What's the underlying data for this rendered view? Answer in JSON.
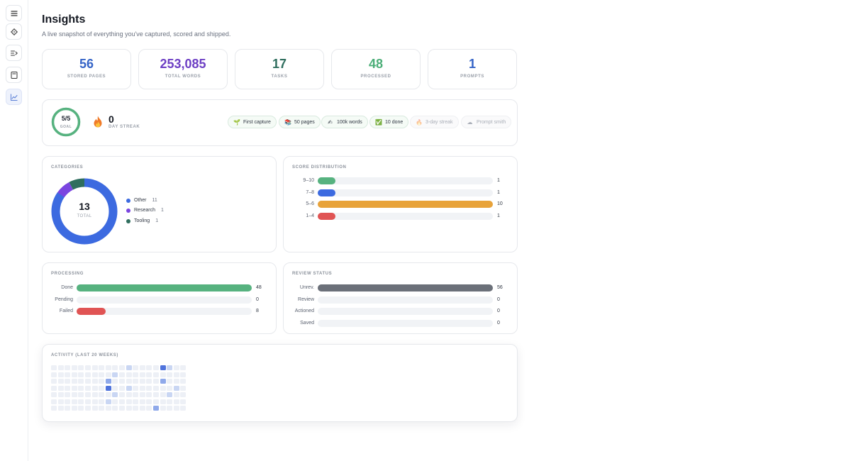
{
  "sidebar": {
    "items": [
      {
        "icon": "menu-icon",
        "active": false
      },
      {
        "icon": "target-icon",
        "active": false
      },
      {
        "icon": "list-arrow-icon",
        "active": false
      },
      {
        "icon": "note-icon",
        "active": false
      },
      {
        "icon": "chart-line-icon",
        "active": true
      }
    ]
  },
  "header": {
    "title": "Insights",
    "subtitle": "A live snapshot of everything you've captured, scored and shipped."
  },
  "stats": [
    {
      "value": "56",
      "label": "STORED PAGES",
      "color": "#3564c7"
    },
    {
      "value": "253,085",
      "label": "TOTAL WORDS",
      "color": "#6d3fc4"
    },
    {
      "value": "17",
      "label": "TASKS",
      "color": "#2f6e5e"
    },
    {
      "value": "48",
      "label": "PROCESSED",
      "color": "#4cae78"
    },
    {
      "value": "1",
      "label": "PROMPTS",
      "color": "#3564c7"
    }
  ],
  "streak": {
    "goal_value": "5/5",
    "goal_label": "GOAL",
    "goal_fraction": 1.0,
    "goal_color": "#56b27f",
    "days": "0",
    "days_label": "DAY STREAK"
  },
  "badges": [
    {
      "icon": "seedling-icon",
      "glyph": "🌱",
      "label": "First capture",
      "earned": true
    },
    {
      "icon": "books-icon",
      "glyph": "📚",
      "label": "50 pages",
      "earned": true
    },
    {
      "icon": "writing-hand-icon",
      "glyph": "✍",
      "label": "100k words",
      "earned": true
    },
    {
      "icon": "check-box-icon",
      "glyph": "✅",
      "label": "10 done",
      "earned": true
    },
    {
      "icon": "fire-icon",
      "glyph": "🔥",
      "label": "3-day streak",
      "earned": false
    },
    {
      "icon": "cloud-icon",
      "glyph": "☁",
      "label": "Prompt smith",
      "earned": false
    }
  ],
  "categories": {
    "title": "CATEGORIES",
    "total": "13",
    "total_label": "TOTAL",
    "items": [
      {
        "label": "Other",
        "count": 11,
        "count_text": "11",
        "color": "#3c6ae0"
      },
      {
        "label": "Research",
        "count": 1,
        "count_text": "1",
        "color": "#7a45e0"
      },
      {
        "label": "Tooling",
        "count": 1,
        "count_text": "1",
        "color": "#2f6e5e"
      }
    ]
  },
  "score_distribution": {
    "title": "SCORE DISTRIBUTION",
    "max": 10,
    "rows": [
      {
        "label": "9–10",
        "value": 1,
        "value_text": "1",
        "color": "#56b27f"
      },
      {
        "label": "7–8",
        "value": 1,
        "value_text": "1",
        "color": "#3c6ae0"
      },
      {
        "label": "5–6",
        "value": 10,
        "value_text": "10",
        "color": "#e8a33a"
      },
      {
        "label": "1–4",
        "value": 1,
        "value_text": "1",
        "color": "#e05454"
      }
    ]
  },
  "processing": {
    "title": "PROCESSING",
    "max": 48,
    "rows": [
      {
        "label": "Done",
        "value": 48,
        "value_text": "48",
        "color": "#56b27f"
      },
      {
        "label": "Pending",
        "value": 0,
        "value_text": "0",
        "color": "#e8a33a"
      },
      {
        "label": "Failed",
        "value": 8,
        "value_text": "8",
        "color": "#e05454"
      }
    ]
  },
  "review_status": {
    "title": "REVIEW STATUS",
    "max": 56,
    "rows": [
      {
        "label": "Unrev.",
        "value": 56,
        "value_text": "56",
        "color": "#6b7079"
      },
      {
        "label": "Review",
        "value": 0,
        "value_text": "0",
        "color": "#3c6ae0"
      },
      {
        "label": "Actioned",
        "value": 0,
        "value_text": "0",
        "color": "#56b27f"
      },
      {
        "label": "Saved",
        "value": 0,
        "value_text": "0",
        "color": "#e8a33a"
      }
    ]
  },
  "activity": {
    "title": "ACTIVITY (LAST 20 WEEKS)",
    "weeks": 20,
    "days": 7,
    "levels": {
      "0": "#edf0f6",
      "1": "#c9d6f3",
      "2": "#8fa9ea",
      "3": "#4f73dc"
    },
    "active_cells": [
      {
        "week": 9,
        "day": 1,
        "level": 1
      },
      {
        "week": 8,
        "day": 3,
        "level": 3
      },
      {
        "week": 8,
        "day": 2,
        "level": 2
      },
      {
        "week": 9,
        "day": 4,
        "level": 1
      },
      {
        "week": 11,
        "day": 0,
        "level": 1
      },
      {
        "week": 11,
        "day": 3,
        "level": 1
      },
      {
        "week": 8,
        "day": 5,
        "level": 1
      },
      {
        "week": 16,
        "day": 0,
        "level": 3
      },
      {
        "week": 17,
        "day": 0,
        "level": 1
      },
      {
        "week": 16,
        "day": 2,
        "level": 2
      },
      {
        "week": 18,
        "day": 3,
        "level": 1
      },
      {
        "week": 15,
        "day": 6,
        "level": 2
      },
      {
        "week": 17,
        "day": 4,
        "level": 1
      }
    ]
  }
}
